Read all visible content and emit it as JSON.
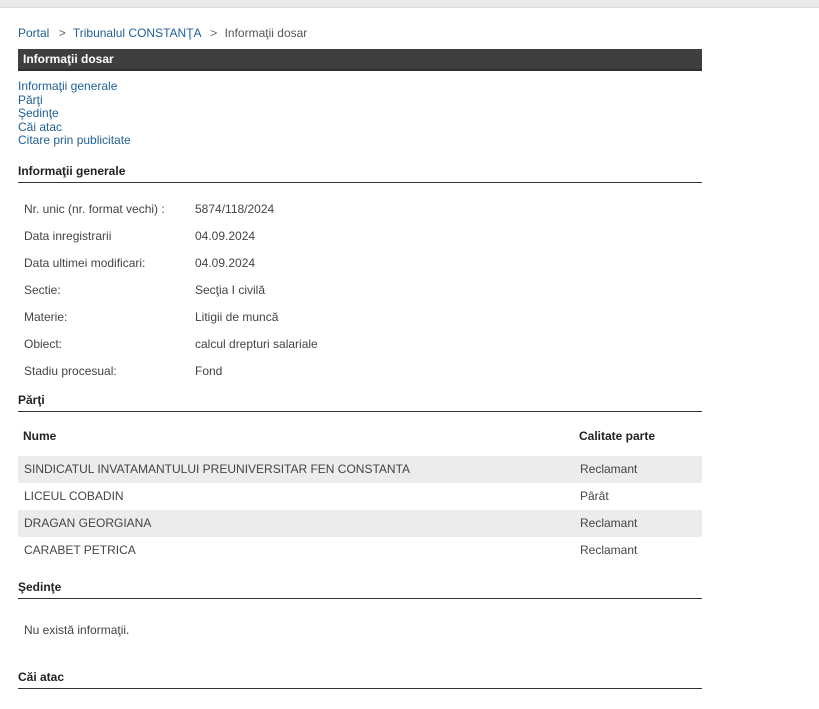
{
  "breadcrumb": {
    "items": [
      "Portal",
      "Tribunalul CONSTANŢA"
    ],
    "current": "Informaţii dosar",
    "separator": ">"
  },
  "title": "Informaţii dosar",
  "nav_links": [
    "Informaţii generale",
    "Părţi",
    "Şedinţe",
    "Căi atac",
    "Citare prin publicitate"
  ],
  "sections": {
    "general": {
      "heading": "Informaţii generale",
      "rows": [
        {
          "label": "Nr. unic (nr. format vechi) :",
          "value": "5874/118/2024"
        },
        {
          "label": "Data inregistrarii",
          "value": "04.09.2024"
        },
        {
          "label": "Data ultimei modificari:",
          "value": "04.09.2024"
        },
        {
          "label": "Sectie:",
          "value": "Secţia I civilă"
        },
        {
          "label": "Materie:",
          "value": "Litigii de muncă"
        },
        {
          "label": "Obiect:",
          "value": "calcul drepturi salariale"
        },
        {
          "label": "Stadiu procesual:",
          "value": "Fond"
        }
      ]
    },
    "parti": {
      "heading": "Părţi",
      "columns": [
        "Nume",
        "Calitate parte"
      ],
      "rows": [
        {
          "nume": "SINDICATUL INVATAMANTULUI PREUNIVERSITAR FEN CONSTANTA",
          "calitate": "Reclamant"
        },
        {
          "nume": "LICEUL COBADIN",
          "calitate": "Pârât"
        },
        {
          "nume": "DRAGAN GEORGIANA",
          "calitate": "Reclamant"
        },
        {
          "nume": "CARABET PETRICA",
          "calitate": "Reclamant"
        }
      ]
    },
    "sedinte": {
      "heading": "Şedinţe",
      "empty_text": "Nu există informaţii."
    },
    "cai_atac": {
      "heading": "Căi atac"
    }
  },
  "colors": {
    "link": "#1f5f95",
    "title_bar": "#3f3f3f",
    "row_stripe": "#ececec"
  }
}
